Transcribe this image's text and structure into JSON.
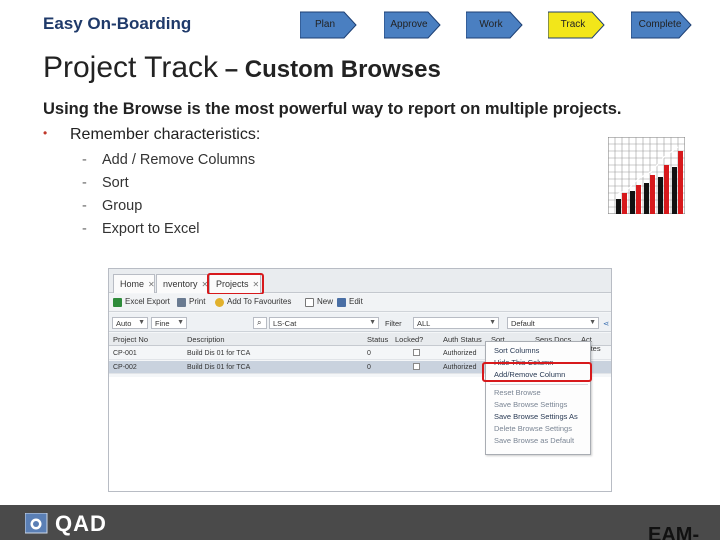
{
  "header": {
    "brand": "Easy On-Boarding",
    "steps": [
      {
        "label": "Plan",
        "active": false
      },
      {
        "label": "Approve",
        "active": false
      },
      {
        "label": "Work",
        "active": false
      },
      {
        "label": "Track",
        "active": true
      },
      {
        "label": "Complete",
        "active": false
      }
    ]
  },
  "slide": {
    "title_main": "Project Track",
    "title_sub": " – Custom Browses",
    "lead": "Using the Browse is the most powerful way to report on multiple projects.",
    "bullet": "Remember characteristics:",
    "bullet_marker": "•",
    "sub_items": [
      "Add / Remove Columns",
      "Sort",
      "Group",
      "Export to Excel"
    ],
    "sub_marker": "-"
  },
  "app": {
    "tabs": [
      "Home",
      "nventory",
      "Projects"
    ],
    "toolbar": [
      "Excel Export",
      "Print",
      "Add To Favourites",
      "New",
      "Edit"
    ],
    "filter": {
      "field1": "Auto",
      "field2": "Fine",
      "search": "LS-Cat",
      "filter_label": "Filter",
      "filter_value": "ALL",
      "view": "Default"
    },
    "columns": [
      "Project No",
      "Description",
      "Status",
      "Locked?",
      "Auth Status",
      "Sort",
      "Sens Docs",
      "Act Dates"
    ],
    "rows": [
      {
        "project": "CP-001",
        "description": "Build Dis 01 for TCA",
        "status": "0",
        "auth": "Authorized"
      },
      {
        "project": "CP-002",
        "description": "Build Dis 01 for TCA",
        "status": "0",
        "auth": "Authorized"
      }
    ],
    "menu": {
      "group1": [
        "Sort Columns",
        "Hide This Column",
        "Add/Remove Column"
      ],
      "group2": [
        "Reset Browse",
        "Save Browse Settings",
        "Save Browse Settings As",
        "Delete Browse Settings",
        "Save Browse as Default"
      ]
    }
  },
  "footer": {
    "logo": "QAD",
    "tag": "EAM-"
  },
  "colors": {
    "accent_red": "#d7191c",
    "arrow_fill": "#4a7fc1",
    "arrow_active": "#f2e61a",
    "footer_bg": "#4a4a4a"
  }
}
